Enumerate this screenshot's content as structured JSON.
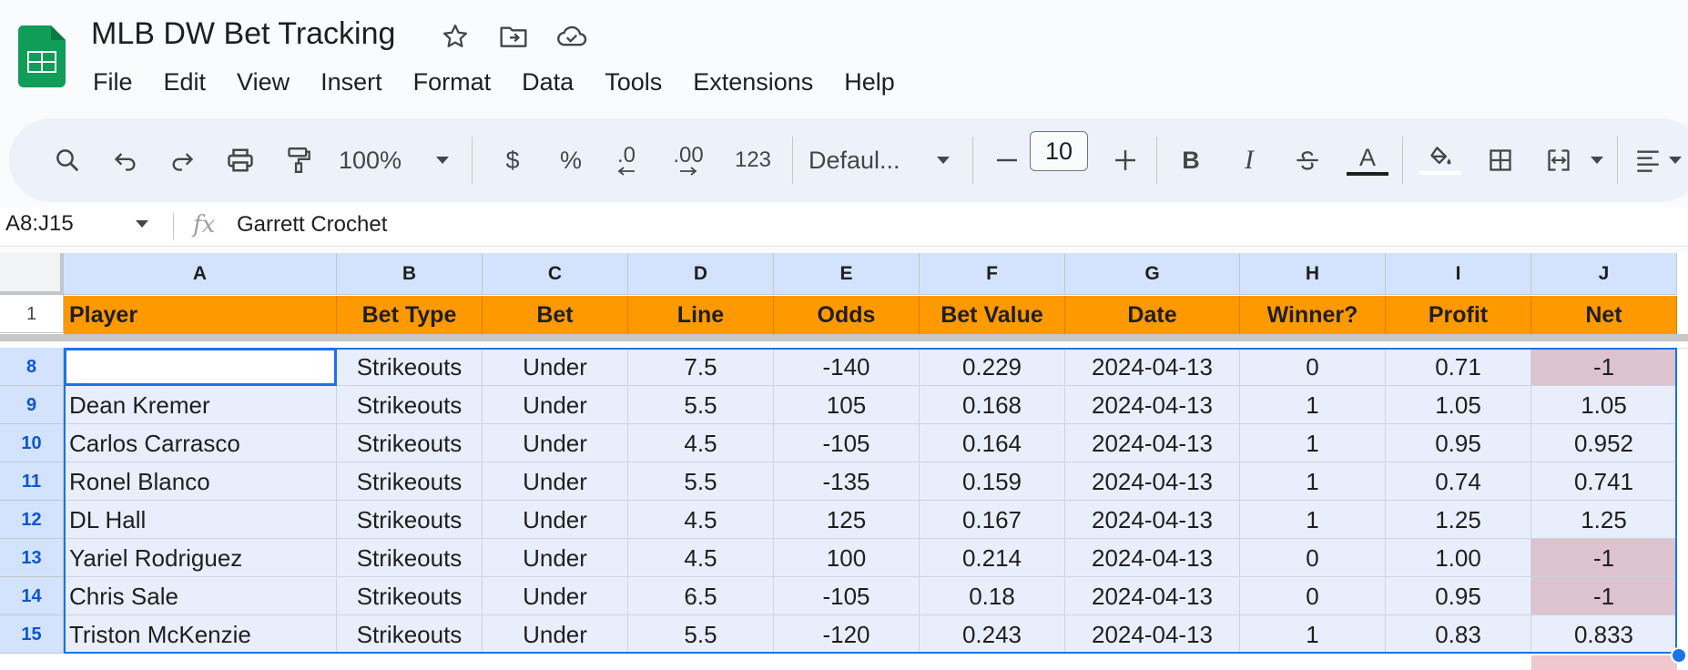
{
  "title": "MLB DW Bet Tracking",
  "menu": [
    "File",
    "Edit",
    "View",
    "Insert",
    "Format",
    "Data",
    "Tools",
    "Extensions",
    "Help"
  ],
  "toolbar": {
    "zoom": "100%",
    "currency": "$",
    "percent": "%",
    "decrease_decimal": ".0",
    "increase_decimal": ".00",
    "number_format": "123",
    "font": "Defaul...",
    "font_size": "10",
    "bold": "B",
    "italic": "I",
    "text_color_glyph": "A"
  },
  "formula_bar": {
    "name_box": "A8:J15",
    "fx": "fx",
    "value": "Garrett Crochet"
  },
  "columns": [
    "A",
    "B",
    "C",
    "D",
    "E",
    "F",
    "G",
    "H",
    "I",
    "J"
  ],
  "header_row_number": "1",
  "headers": [
    "Player",
    "Bet Type",
    "Bet",
    "Line",
    "Odds",
    "Bet Value",
    "Date",
    "Winner?",
    "Profit",
    "Net"
  ],
  "rows": [
    {
      "num": "8",
      "cells": [
        "Garrett Crochet",
        "Strikeouts",
        "Under",
        "7.5",
        "-140",
        "0.229",
        "2024-04-13",
        "0",
        "0.71",
        "-1"
      ]
    },
    {
      "num": "9",
      "cells": [
        "Dean Kremer",
        "Strikeouts",
        "Under",
        "5.5",
        "105",
        "0.168",
        "2024-04-13",
        "1",
        "1.05",
        "1.05"
      ]
    },
    {
      "num": "10",
      "cells": [
        "Carlos Carrasco",
        "Strikeouts",
        "Under",
        "4.5",
        "-105",
        "0.164",
        "2024-04-13",
        "1",
        "0.95",
        "0.952"
      ]
    },
    {
      "num": "11",
      "cells": [
        "Ronel Blanco",
        "Strikeouts",
        "Under",
        "5.5",
        "-135",
        "0.159",
        "2024-04-13",
        "1",
        "0.74",
        "0.741"
      ]
    },
    {
      "num": "12",
      "cells": [
        "DL Hall",
        "Strikeouts",
        "Under",
        "4.5",
        "125",
        "0.167",
        "2024-04-13",
        "1",
        "1.25",
        "1.25"
      ]
    },
    {
      "num": "13",
      "cells": [
        "Yariel Rodriguez",
        "Strikeouts",
        "Under",
        "4.5",
        "100",
        "0.214",
        "2024-04-13",
        "0",
        "1.00",
        "-1"
      ]
    },
    {
      "num": "14",
      "cells": [
        "Chris Sale",
        "Strikeouts",
        "Under",
        "6.5",
        "-105",
        "0.18",
        "2024-04-13",
        "0",
        "0.95",
        "-1"
      ]
    },
    {
      "num": "15",
      "cells": [
        "Triston McKenzie",
        "Strikeouts",
        "Under",
        "5.5",
        "-120",
        "0.243",
        "2024-04-13",
        "1",
        "0.83",
        "0.833"
      ]
    }
  ],
  "colors": {
    "header_fill": "#ff9900",
    "column_header_fill": "#d3e3fd",
    "selection_fill": "#e8eefb",
    "selection_border": "#1a73e8",
    "negative_net_fill": "#dcc3cf",
    "app_green": "#0f9d58"
  }
}
